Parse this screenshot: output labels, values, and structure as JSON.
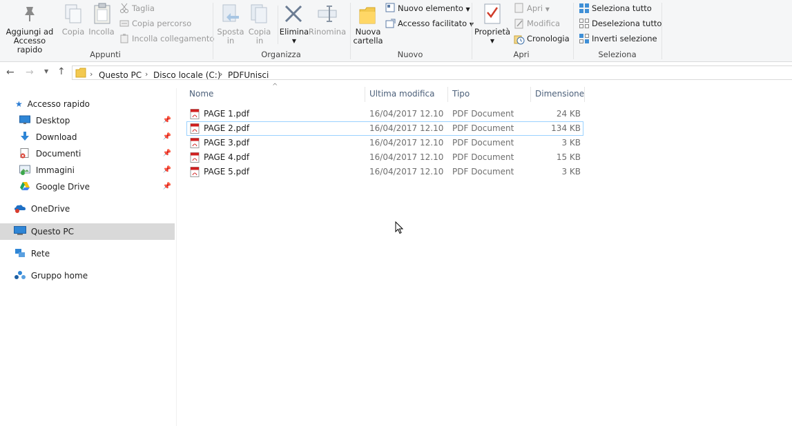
{
  "ribbon": {
    "appunti": {
      "pin_label": "Aggiungi ad Accesso rapido",
      "pin_line1": "Aggiungi ad",
      "pin_line2": "Accesso rapido",
      "copy": "Copia",
      "paste": "Incolla",
      "cut": "Taglia",
      "copy_path": "Copia percorso",
      "paste_link": "Incolla collegamento",
      "group": "Appunti"
    },
    "organizza": {
      "move_line1": "Sposta",
      "move_line2": "in",
      "copy_line1": "Copia",
      "copy_line2": "in",
      "delete": "Elimina",
      "rename": "Rinomina",
      "group": "Organizza"
    },
    "nuovo": {
      "folder_line1": "Nuova",
      "folder_line2": "cartella",
      "new_item": "Nuovo elemento",
      "easy_access": "Accesso facilitato",
      "group": "Nuovo"
    },
    "apri": {
      "properties": "Proprietà",
      "open": "Apri",
      "edit": "Modifica",
      "history": "Cronologia",
      "group": "Apri"
    },
    "seleziona": {
      "select_all": "Seleziona tutto",
      "select_none": "Deseleziona tutto",
      "invert": "Inverti selezione",
      "group": "Seleziona"
    }
  },
  "address": {
    "crumbs": [
      "Questo PC",
      "Disco locale (C:)",
      "PDFUnisci"
    ]
  },
  "nav": {
    "quick_access": "Accesso rapido",
    "pinned": [
      "Desktop",
      "Download",
      "Documenti",
      "Immagini",
      "Google Drive"
    ],
    "onedrive": "OneDrive",
    "this_pc": "Questo PC",
    "network": "Rete",
    "homegroup": "Gruppo home"
  },
  "files": {
    "columns": {
      "name": "Nome",
      "modified": "Ultima modifica",
      "type": "Tipo",
      "size": "Dimensione"
    },
    "rows": [
      {
        "name": "PAGE 1.pdf",
        "modified": "16/04/2017 12.10",
        "type": "PDF Document",
        "size": "24 KB"
      },
      {
        "name": "PAGE 2.pdf",
        "modified": "16/04/2017 12.10",
        "type": "PDF Document",
        "size": "134 KB"
      },
      {
        "name": "PAGE 3.pdf",
        "modified": "16/04/2017 12.10",
        "type": "PDF Document",
        "size": "3 KB"
      },
      {
        "name": "PAGE 4.pdf",
        "modified": "16/04/2017 12.10",
        "type": "PDF Document",
        "size": "15 KB"
      },
      {
        "name": "PAGE 5.pdf",
        "modified": "16/04/2017 12.10",
        "type": "PDF Document",
        "size": "3 KB"
      }
    ],
    "selected_index": 1
  },
  "colors": {
    "accent": "#0078d7",
    "selection_border": "#99d1ff",
    "nav_selected": "#d9d9d9",
    "pdf_red": "#d01f1f"
  }
}
